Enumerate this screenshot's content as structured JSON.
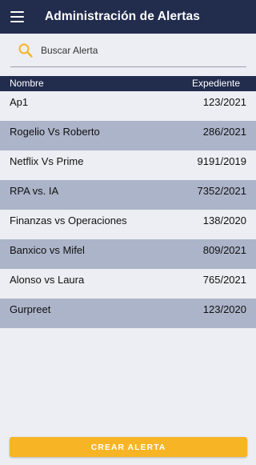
{
  "app_bar": {
    "menu_icon": "hamburger-menu-icon",
    "title": "Administración de Alertas",
    "color": "#222c4d"
  },
  "search": {
    "icon": "search-icon",
    "placeholder": "Buscar Alerta",
    "value": "",
    "icon_color": "#f7b425"
  },
  "table": {
    "headers": {
      "name": "Nombre",
      "expediente": "Expediente"
    },
    "rows": [
      {
        "name": "Ap1",
        "expediente": "123/2021"
      },
      {
        "name": "Rogelio Vs Roberto",
        "expediente": "286/2021"
      },
      {
        "name": "Netflix Vs Prime",
        "expediente": "9191/2019"
      },
      {
        "name": "RPA vs. IA",
        "expediente": "7352/2021"
      },
      {
        "name": "Finanzas vs Operaciones",
        "expediente": "138/2020"
      },
      {
        "name": "Banxico vs Mifel",
        "expediente": "809/2021"
      },
      {
        "name": "Alonso vs Laura",
        "expediente": "765/2021"
      },
      {
        "name": "Gurpreet",
        "expediente": "123/2020"
      }
    ],
    "row_colors": [
      "#eceef3",
      "#acb4c9"
    ]
  },
  "actions": {
    "create_label": "CREAR ALERTA",
    "create_color": "#f7b425"
  }
}
